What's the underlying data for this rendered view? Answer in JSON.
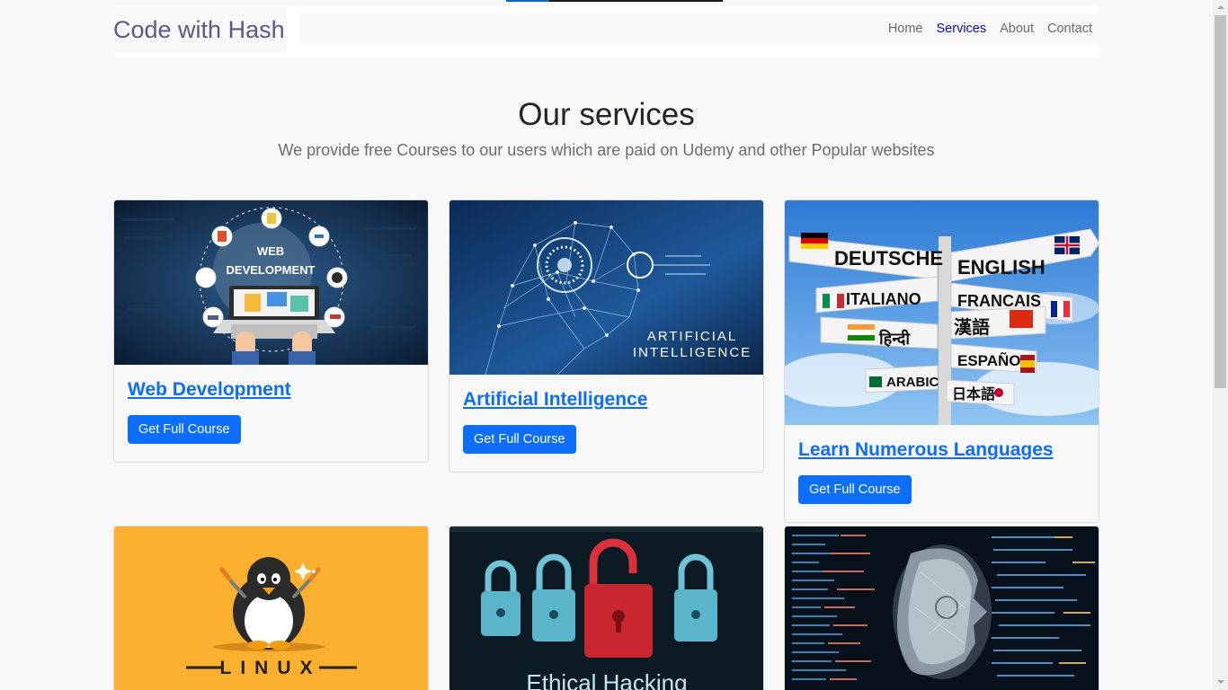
{
  "header": {
    "brand": "Code with Hash",
    "nav": [
      {
        "label": "Home",
        "active": false
      },
      {
        "label": "Services",
        "active": true
      },
      {
        "label": "About",
        "active": false
      },
      {
        "label": "Contact",
        "active": false
      }
    ]
  },
  "services": {
    "title": "Our services",
    "subtitle": "We provide free Courses to our users which are paid on Udemy and other Popular websites"
  },
  "cards": [
    {
      "title": "Web Development",
      "button": "Get Full Course",
      "image_label_1": "WEB",
      "image_label_2": "DEVELOPMENT"
    },
    {
      "title": "Artificial Intelligence",
      "button": "Get Full Course",
      "image_label_1": "ARTIFICIAL",
      "image_label_2": "INTELLIGENCE"
    },
    {
      "title": "Learn Numerous Languages",
      "button": "Get Full Course",
      "signs": [
        "DEUTSCHE",
        "ENGLISH",
        "ITALIANO",
        "FRANCAIS",
        "हिन्दी",
        "漢語",
        "ESPAÑOL",
        "ARABIC",
        "日本語"
      ]
    },
    {
      "image_label": "LINUX"
    },
    {
      "image_label": "Ethical Hacking"
    },
    {
      "image_label": ""
    }
  ],
  "colors": {
    "accent": "#0d6efd",
    "nav_active": "#0d0da8",
    "brand_text": "#5a5a82",
    "linux_bg": "#fbb12f"
  }
}
